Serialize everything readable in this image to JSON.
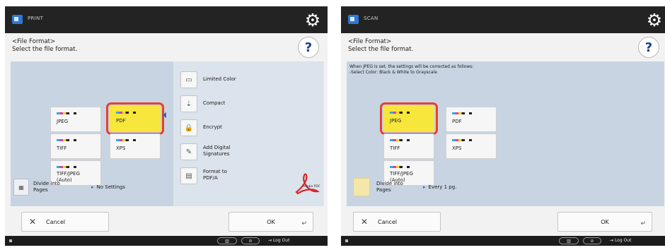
{
  "colors": {
    "accent_selected": "#f7e63b",
    "selection_outline": "#e8402e",
    "panel": "#c8d4e2",
    "topbar": "#232323"
  },
  "left": {
    "app_name": "PRINT",
    "header_line1": "<File Format>",
    "header_line2": "Select the file format.",
    "help_label": "?",
    "formats": [
      {
        "label": "JPEG",
        "selected": false
      },
      {
        "label": "PDF",
        "selected": true
      },
      {
        "label": "TIFF",
        "selected": false
      },
      {
        "label": "XPS",
        "selected": false
      },
      {
        "label_line1": "TIFF/JPEG",
        "label_line2": "(Auto)",
        "selected": false
      }
    ],
    "options": [
      {
        "icon": "limited-color-icon",
        "label": "Limited Color"
      },
      {
        "icon": "compact-icon",
        "label": "Compact"
      },
      {
        "icon": "encrypt-icon",
        "label": "Encrypt"
      },
      {
        "icon": "digital-signature-icon",
        "label_line1": "Add Digital",
        "label_line2": "Signatures"
      },
      {
        "icon": "pdfa-icon",
        "label_line1": "Format to",
        "label_line2": "PDF/A"
      }
    ],
    "divide_line1": "Divide into",
    "divide_line2": "Pages",
    "divide_value": "No Settings",
    "cancel_label": "Cancel",
    "ok_label": "OK",
    "logout_label": "Log Out"
  },
  "right": {
    "app_name": "SCAN",
    "header_line1": "<File Format>",
    "header_line2": "Select the file format.",
    "help_label": "?",
    "note_line1": "When JPEG is set, the settings will be corrected as follows:",
    "note_line2": "-Select Color: Black & White to Grayscale",
    "formats": [
      {
        "label": "JPEG",
        "selected": true
      },
      {
        "label": "PDF",
        "selected": false
      },
      {
        "label": "TIFF",
        "selected": false
      },
      {
        "label": "XPS",
        "selected": false
      },
      {
        "label_line1": "TIFF/JPEG",
        "label_line2": "(Auto)",
        "selected": false
      }
    ],
    "divide_line1": "Divide into",
    "divide_line2": "Pages",
    "divide_value": "Every 1 pg.",
    "cancel_label": "Cancel",
    "ok_label": "OK",
    "logout_label": "Log Out"
  }
}
